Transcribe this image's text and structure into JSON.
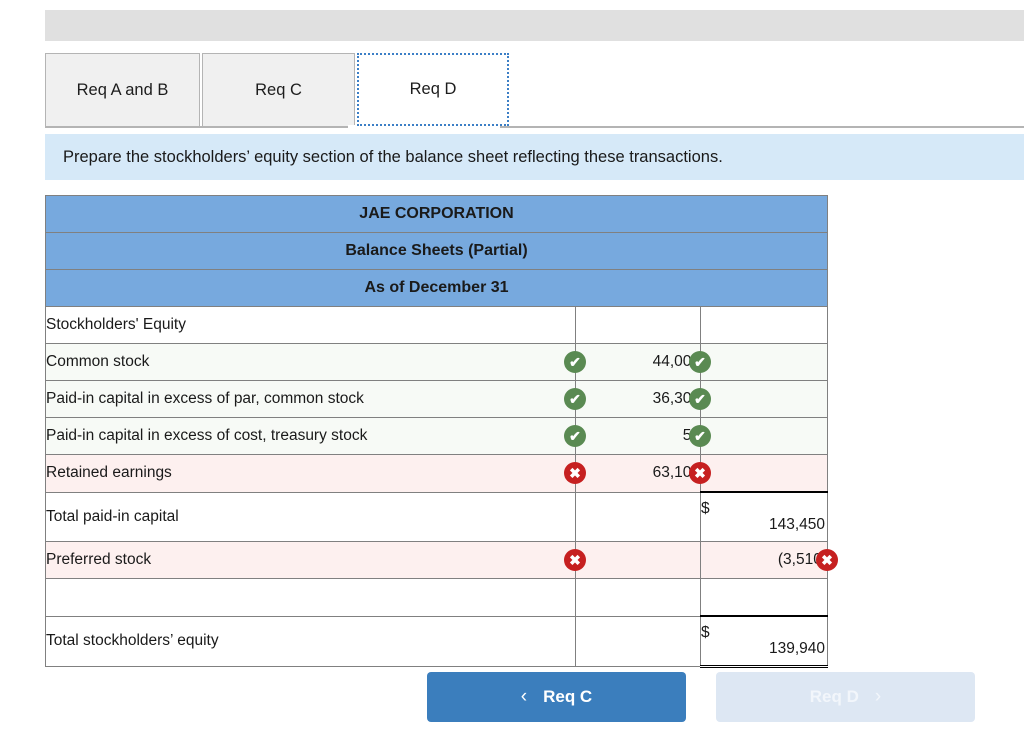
{
  "tabs": [
    {
      "label": "Req A and B",
      "active": false
    },
    {
      "label": "Req C",
      "active": false
    },
    {
      "label": "Req D",
      "active": true
    }
  ],
  "instruction": {
    "text": "Prepare the stockholders’ equity section of the balance sheet reflecting these transactions."
  },
  "sheet": {
    "headers": [
      "JAE CORPORATION",
      "Balance Sheets (Partial)",
      "As of December 31"
    ],
    "rows": [
      {
        "label": "Stockholders' Equity",
        "label_mark": "",
        "mid": "",
        "mid_currency": "",
        "mid_mark": "",
        "right": "",
        "right_currency": "",
        "right_mark": "",
        "state": "plain"
      },
      {
        "label": "Common stock",
        "label_mark": "ok",
        "mid": "44,000",
        "mid_currency": "$",
        "mid_mark": "ok",
        "right": "",
        "right_currency": "",
        "right_mark": "",
        "state": "ok"
      },
      {
        "label": "Paid-in capital in excess of par, common stock",
        "label_mark": "ok",
        "mid": "36,300",
        "mid_currency": "",
        "mid_mark": "ok",
        "right": "",
        "right_currency": "",
        "right_mark": "",
        "state": "ok"
      },
      {
        "label": "Paid-in capital in excess of cost, treasury stock",
        "label_mark": "ok",
        "mid": "50",
        "mid_currency": "",
        "mid_mark": "ok",
        "right": "",
        "right_currency": "",
        "right_mark": "",
        "state": "ok"
      },
      {
        "label": "Retained earnings",
        "label_mark": "bad",
        "mid": "63,100",
        "mid_currency": "",
        "mid_mark": "bad",
        "right": "",
        "right_currency": "",
        "right_mark": "",
        "state": "bad"
      },
      {
        "label": "Total paid-in capital",
        "label_mark": "",
        "mid": "",
        "mid_currency": "",
        "mid_mark": "",
        "right": "143,450",
        "right_currency": "$",
        "right_mark": "",
        "state": "plain",
        "right_style": "total"
      },
      {
        "label": "Preferred stock",
        "label_mark": "bad",
        "mid": "",
        "mid_currency": "",
        "mid_mark": "",
        "right": "(3,510)",
        "right_currency": "",
        "right_mark": "bad",
        "state": "bad"
      },
      {
        "label": "",
        "label_mark": "",
        "mid": "",
        "mid_currency": "",
        "mid_mark": "",
        "right": "",
        "right_currency": "",
        "right_mark": "",
        "state": "plain"
      },
      {
        "label": "Total stockholders’ equity",
        "label_mark": "",
        "mid": "",
        "mid_currency": "",
        "mid_mark": "",
        "right": "139,940",
        "right_currency": "$",
        "right_mark": "",
        "state": "plain",
        "right_style": "total-double"
      }
    ]
  },
  "nav": {
    "prev_label": "Req C",
    "prev_chevron": "‹",
    "next_label": "Req D",
    "next_chevron": "›"
  },
  "colors": {
    "header_blue": "#77a9de",
    "instruction_blue": "#d6e9f8",
    "ok_green": "#5a8a52",
    "bad_red": "#c62020",
    "primary_button": "#3b7ebd",
    "disabled_button": "#dde7f3"
  },
  "marks": {
    "ok_glyph": "✔",
    "bad_glyph": "✖"
  }
}
